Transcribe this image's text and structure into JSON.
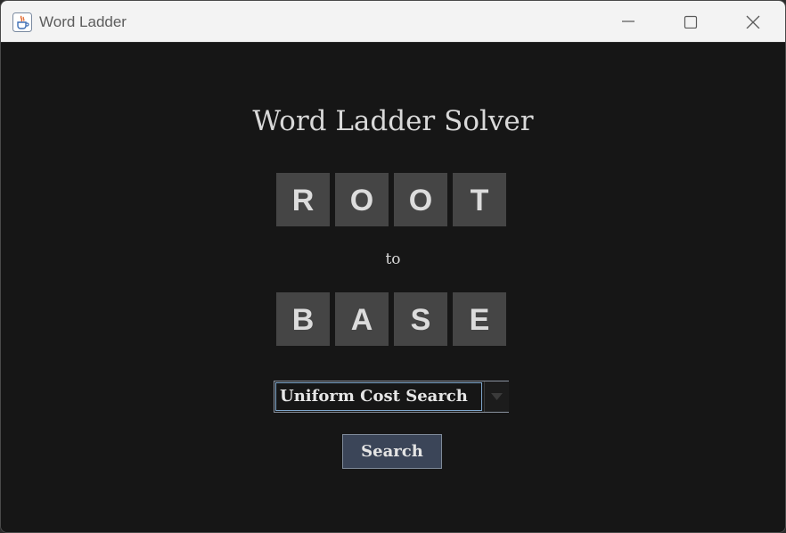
{
  "window": {
    "title": "Word Ladder",
    "app_icon": "java-coffee-cup-icon",
    "controls": [
      "minimize-icon",
      "maximize-icon",
      "close-icon"
    ]
  },
  "main": {
    "heading": "Word Ladder Solver",
    "start_word": [
      "R",
      "O",
      "O",
      "T"
    ],
    "separator": "to",
    "end_word": [
      "B",
      "A",
      "S",
      "E"
    ],
    "algorithm_select": {
      "selected": "Uniform Cost Search"
    },
    "search_button": "Search"
  },
  "colors": {
    "background": "#161616",
    "tile": "#454545",
    "tile_text": "#dcdcdc",
    "button": "#3b4558",
    "select_focus": "#7fa7cc"
  }
}
